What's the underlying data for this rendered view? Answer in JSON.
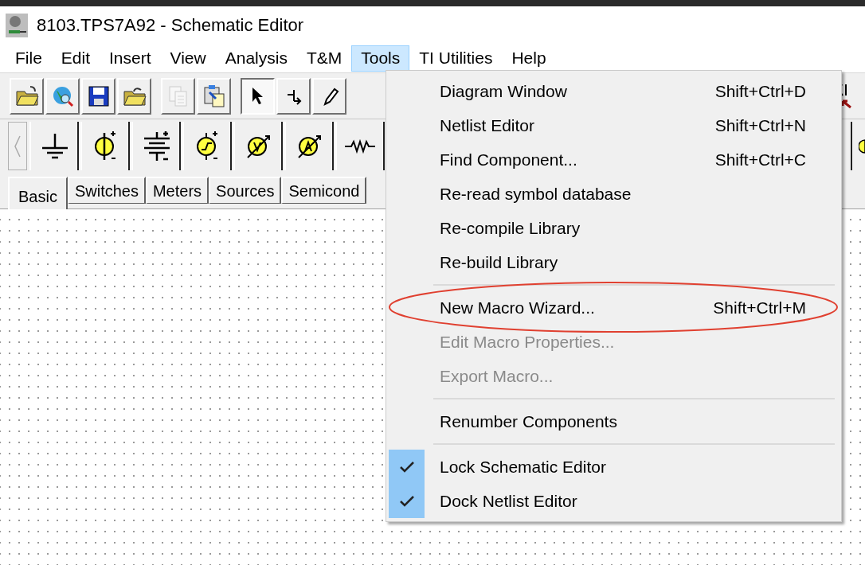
{
  "window": {
    "title": "8103.TPS7A92 - Schematic Editor"
  },
  "menu_bar": [
    {
      "label": "File",
      "selected": false
    },
    {
      "label": "Edit",
      "selected": false
    },
    {
      "label": "Insert",
      "selected": false
    },
    {
      "label": "View",
      "selected": false
    },
    {
      "label": "Analysis",
      "selected": false
    },
    {
      "label": "T&M",
      "selected": false
    },
    {
      "label": "Tools",
      "selected": true
    },
    {
      "label": "TI Utilities",
      "selected": false
    },
    {
      "label": "Help",
      "selected": false
    }
  ],
  "toolbar": [
    {
      "disabled": false,
      "pressed": false
    },
    {
      "disabled": false,
      "pressed": false
    },
    {
      "disabled": false,
      "pressed": false
    },
    {
      "disabled": false,
      "pressed": false
    },
    {
      "disabled": true,
      "pressed": false
    },
    {
      "disabled": false,
      "pressed": false
    },
    {
      "disabled": false,
      "pressed": true
    },
    {
      "disabled": false,
      "pressed": false
    },
    {
      "disabled": false,
      "pressed": false
    }
  ],
  "component_tabs": [
    {
      "label": "Basic",
      "selected": true
    },
    {
      "label": "Switches",
      "selected": false
    },
    {
      "label": "Meters",
      "selected": false
    },
    {
      "label": "Sources",
      "selected": false
    },
    {
      "label": "Semicond",
      "selected": false
    }
  ],
  "tools_menu": {
    "items": [
      {
        "kind": "item",
        "label": "Diagram Window",
        "shortcut": "Shift+Ctrl+D",
        "disabled": false,
        "checked": false,
        "highlighted": false
      },
      {
        "kind": "item",
        "label": "Netlist Editor",
        "shortcut": "Shift+Ctrl+N",
        "disabled": false,
        "checked": false,
        "highlighted": false
      },
      {
        "kind": "item",
        "label": "Find Component...",
        "shortcut": "Shift+Ctrl+C",
        "disabled": false,
        "checked": false,
        "highlighted": false
      },
      {
        "kind": "item",
        "label": "Re-read symbol database",
        "disabled": false,
        "checked": false,
        "highlighted": false
      },
      {
        "kind": "item",
        "label": "Re-compile Library",
        "disabled": false,
        "checked": false,
        "highlighted": false
      },
      {
        "kind": "item",
        "label": "Re-build Library",
        "disabled": false,
        "checked": false,
        "highlighted": false
      },
      {
        "kind": "separator"
      },
      {
        "kind": "item",
        "label": "New Macro Wizard...",
        "shortcut": "Shift+Ctrl+M",
        "disabled": false,
        "checked": false,
        "highlighted": true
      },
      {
        "kind": "item",
        "label": "Edit Macro Properties...",
        "disabled": true,
        "checked": false,
        "highlighted": false
      },
      {
        "kind": "item",
        "label": "Export Macro...",
        "disabled": true,
        "checked": false,
        "highlighted": false
      },
      {
        "kind": "separator"
      },
      {
        "kind": "item",
        "label": "Renumber Components",
        "disabled": false,
        "checked": false,
        "highlighted": false
      },
      {
        "kind": "separator"
      },
      {
        "kind": "item",
        "label": "Lock Schematic Editor",
        "disabled": false,
        "checked": true,
        "highlighted": false
      },
      {
        "kind": "item",
        "label": "Dock Netlist Editor",
        "disabled": false,
        "checked": true,
        "highlighted": false
      }
    ]
  }
}
